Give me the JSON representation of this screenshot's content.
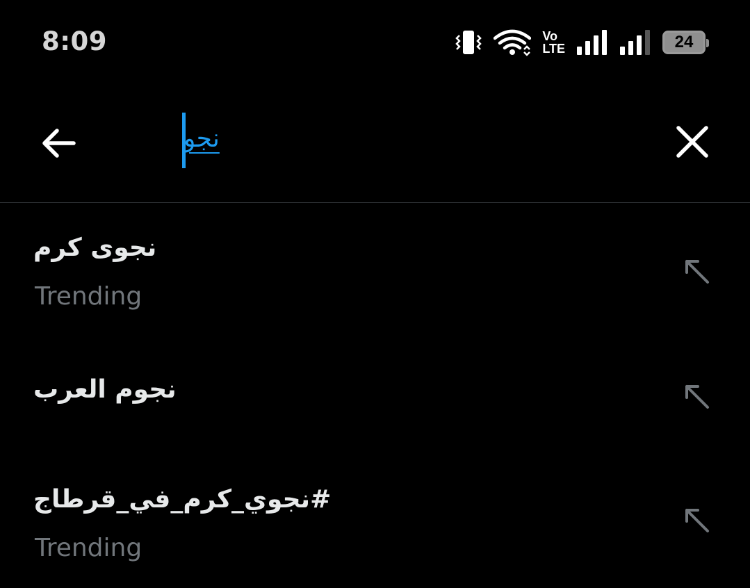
{
  "status_bar": {
    "time": "8:09",
    "icons": [
      "vibrate-icon",
      "wifi-icon",
      "volte-icon",
      "signal-sim1-icon",
      "signal-sim2-icon",
      "battery-icon"
    ],
    "volte_top": "Vo",
    "volte_bottom": "LTE",
    "battery_level": "24"
  },
  "search": {
    "query": "نجو",
    "back_icon": "arrow-left-icon",
    "clear_icon": "close-icon",
    "accent_color": "#1d9bf0"
  },
  "suggestions": [
    {
      "title": "نجوى كرم",
      "subtitle": "Trending",
      "action_icon": "arrow-up-left-icon"
    },
    {
      "title": "نجوم العرب",
      "subtitle": "",
      "action_icon": "arrow-up-left-icon"
    },
    {
      "title": "#نجوي_كرم_في_قرطاج",
      "subtitle": "Trending",
      "action_icon": "arrow-up-left-icon"
    }
  ],
  "colors": {
    "background": "#000000",
    "primary_text": "#e7e9ea",
    "secondary_text": "#71767b",
    "divider": "#2f3336"
  }
}
